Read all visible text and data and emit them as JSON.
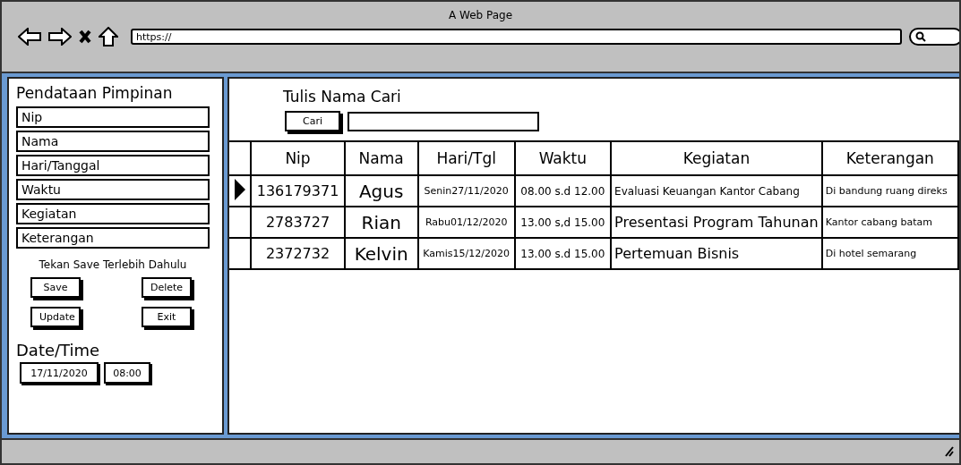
{
  "window": {
    "title": "A Web Page",
    "url": "https://"
  },
  "form": {
    "title": "Pendataan Pimpinan",
    "fields": [
      {
        "value": "Nip"
      },
      {
        "value": "Nama"
      },
      {
        "value": "Hari/Tanggal"
      },
      {
        "value": "Waktu"
      },
      {
        "value": "Kegiatan"
      },
      {
        "value": "Keterangan"
      }
    ],
    "hint": "Tekan Save Terlebih Dahulu",
    "buttons": [
      "Save",
      "Delete",
      "Update",
      "Exit"
    ],
    "datetime_label": "Date/Time",
    "date": "17/11/2020",
    "time": "08:00"
  },
  "search": {
    "label": "Tulis Nama Cari",
    "button": "Cari"
  },
  "table": {
    "columns": [
      "Nip",
      "Nama",
      "Hari/Tgl",
      "Waktu",
      "Kegiatan",
      "Keterangan"
    ],
    "rows": [
      {
        "selected": true,
        "cells": [
          "136179371",
          "Agus",
          "Senin27/11/2020",
          "08.00 s.d 12.00",
          "Evaluasi Keuangan Kantor Cabang",
          "Di bandung ruang direks"
        ]
      },
      {
        "selected": false,
        "cells": [
          "2783727",
          "Rian",
          "Rabu01/12/2020",
          "13.00 s,d 15.00",
          "Presentasi Program Tahunan",
          "Kantor cabang batam"
        ]
      },
      {
        "selected": false,
        "cells": [
          "2372732",
          "Kelvin",
          "Kamis15/12/2020",
          "13.00 s.d 15.00",
          "Pertemuan Bisnis",
          "Di hotel semarang"
        ]
      }
    ]
  }
}
